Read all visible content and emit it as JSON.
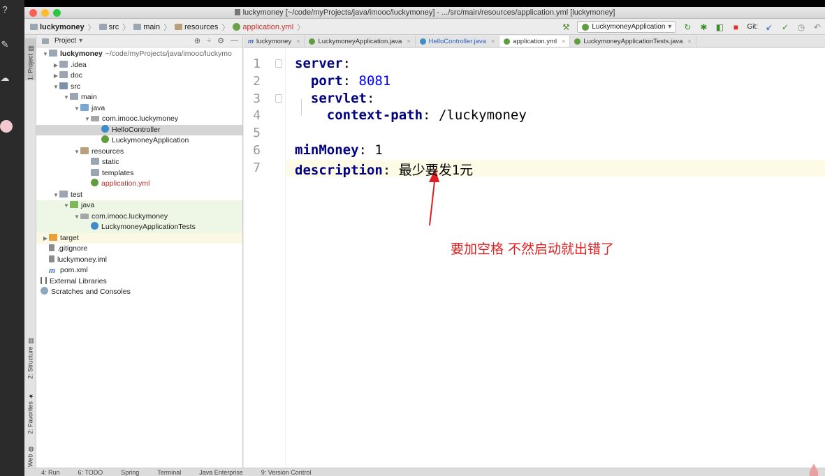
{
  "window": {
    "title": "luckymoney [~/code/myProjects/java/imooc/luckymoney] - .../src/main/resources/application.yml [luckymoney]"
  },
  "breadcrumbs": [
    "luckymoney",
    "src",
    "main",
    "resources",
    "application.yml"
  ],
  "toolbar": {
    "run_config": "LuckymoneyApplication",
    "git_label": "Git:"
  },
  "left_strip": {
    "project_tab": "1: Project",
    "structure_tab": "2: Structure",
    "favorites_tab": "2: Favorites",
    "web_tab": "Web"
  },
  "project_panel": {
    "header": "Project",
    "tree": [
      {
        "label": "luckymoney",
        "hint": "~/code/myProjects/java/imooc/luckymo",
        "level": 0,
        "arrow": "▼",
        "icon": "folder",
        "bold": true
      },
      {
        "label": ".idea",
        "level": 1,
        "arrow": "▶",
        "icon": "folder"
      },
      {
        "label": "doc",
        "level": 1,
        "arrow": "▶",
        "icon": "folder"
      },
      {
        "label": "src",
        "level": 1,
        "arrow": "▼",
        "icon": "folder-src"
      },
      {
        "label": "main",
        "level": 2,
        "arrow": "▼",
        "icon": "folder"
      },
      {
        "label": "java",
        "level": 3,
        "arrow": "▼",
        "icon": "folder-blue"
      },
      {
        "label": "com.imooc.luckymoney",
        "level": 4,
        "arrow": "▼",
        "icon": "pkg"
      },
      {
        "label": "HelloController",
        "level": 5,
        "arrow": "",
        "icon": "class",
        "selected": true
      },
      {
        "label": "LuckymoneyApplication",
        "level": 5,
        "arrow": "",
        "icon": "spring"
      },
      {
        "label": "resources",
        "level": 3,
        "arrow": "▼",
        "icon": "folder-res"
      },
      {
        "label": "static",
        "level": 4,
        "arrow": "",
        "icon": "folder"
      },
      {
        "label": "templates",
        "level": 4,
        "arrow": "",
        "icon": "folder"
      },
      {
        "label": "application.yml",
        "level": 4,
        "arrow": "",
        "icon": "spring",
        "red": true
      },
      {
        "label": "test",
        "level": 1,
        "arrow": "▼",
        "icon": "folder"
      },
      {
        "label": "java",
        "level": 2,
        "arrow": "▼",
        "icon": "folder-green",
        "test": true
      },
      {
        "label": "com.imooc.luckymoney",
        "level": 3,
        "arrow": "▼",
        "icon": "pkg",
        "test": true
      },
      {
        "label": "LuckymoneyApplicationTests",
        "level": 4,
        "arrow": "",
        "icon": "class",
        "test": true
      },
      {
        "label": "target",
        "level": 0,
        "arrow": "▶",
        "icon": "folder-orange",
        "target": true
      },
      {
        "label": ".gitignore",
        "level": 0,
        "arrow": "",
        "icon": "file"
      },
      {
        "label": "luckymoney.iml",
        "level": 0,
        "arrow": "",
        "icon": "file"
      },
      {
        "label": "pom.xml",
        "level": 0,
        "arrow": "",
        "icon": "m"
      },
      {
        "label": "External Libraries",
        "level": -1,
        "arrow": "",
        "icon": "lib"
      },
      {
        "label": "Scratches and Consoles",
        "level": -1,
        "arrow": "",
        "icon": "scratch"
      }
    ]
  },
  "tabs": [
    {
      "label": "luckymoney",
      "icon": "m",
      "active": false
    },
    {
      "label": "LuckymoneyApplication.java",
      "icon": "spring",
      "active": false
    },
    {
      "label": "HelloController.java",
      "icon": "cls",
      "active": false,
      "blue": true
    },
    {
      "label": "application.yml",
      "icon": "spring",
      "active": true
    },
    {
      "label": "LuckymoneyApplicationTests.java",
      "icon": "spring",
      "active": false
    }
  ],
  "editor": {
    "lines": [
      {
        "num": "1",
        "key": "server",
        "sep": ":",
        "val": "",
        "valtype": ""
      },
      {
        "num": "2",
        "indent": "  ",
        "key": "port",
        "sep": ": ",
        "val": "8081",
        "valtype": "num"
      },
      {
        "num": "3",
        "indent": "  ",
        "key": "servlet",
        "sep": ":",
        "val": "",
        "valtype": ""
      },
      {
        "num": "4",
        "indent": "    ",
        "key": "context-path",
        "sep": ": ",
        "val": "/luckymoney",
        "valtype": "plain"
      },
      {
        "num": "5",
        "indent": "",
        "key": "",
        "sep": "",
        "val": "",
        "valtype": ""
      },
      {
        "num": "6",
        "indent": "",
        "key": "minMoney",
        "sep": ": ",
        "val": "1",
        "valtype": "plain"
      },
      {
        "num": "7",
        "indent": "",
        "key": "description",
        "sep": ": ",
        "val": "最少要发1元",
        "valtype": "plain"
      }
    ]
  },
  "annotation": {
    "text": "要加空格  不然启动就出错了",
    "color": "#e02020"
  },
  "statusbar": [
    "4: Run",
    "6: TODO",
    "Spring",
    "Terminal",
    "Java Enterprise",
    "9: Version Control"
  ]
}
